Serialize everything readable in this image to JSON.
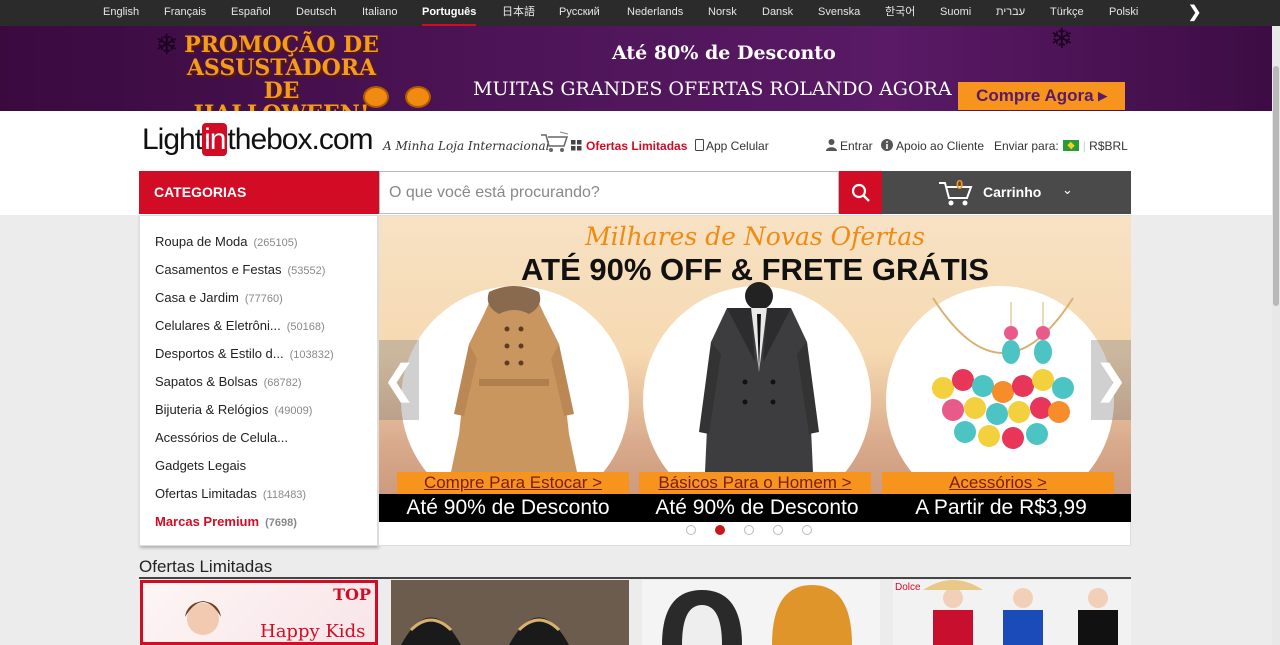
{
  "languages": [
    {
      "label": "English",
      "active": false
    },
    {
      "label": "Français",
      "active": false
    },
    {
      "label": "Español",
      "active": false
    },
    {
      "label": "Deutsch",
      "active": false
    },
    {
      "label": "Italiano",
      "active": false
    },
    {
      "label": "Português",
      "active": true
    },
    {
      "label": "日本語",
      "active": false
    },
    {
      "label": "Русский",
      "active": false
    },
    {
      "label": "Nederlands",
      "active": false
    },
    {
      "label": "Norsk",
      "active": false
    },
    {
      "label": "Dansk",
      "active": false
    },
    {
      "label": "Svenska",
      "active": false
    },
    {
      "label": "한국어",
      "active": false
    },
    {
      "label": "Suomi",
      "active": false
    },
    {
      "label": "עברית",
      "active": false
    },
    {
      "label": "Türkçe",
      "active": false
    },
    {
      "label": "Polski",
      "active": false
    }
  ],
  "promo": {
    "halloween_title": "PROMOÇÃO DE ASSUSTADORA DE HALLOWEEN!",
    "discount": "Até 80% de Desconto",
    "deals": "MUITAS GRANDES OFERTAS ROLANDO AGORA",
    "cta": "Compre Agora ▸"
  },
  "header": {
    "logo_pre": "Light",
    "logo_in": "in",
    "logo_post": "thebox.com",
    "tagline": "A Minha Loja Internacional",
    "limited_offers": "Ofertas Limitadas",
    "app": "App Celular",
    "login": "Entrar",
    "support": "Apoio ao Cliente",
    "ship_to": "Enviar para:",
    "currency": "R$BRL"
  },
  "nav": {
    "categories_label": "CATEGORIAS",
    "search_placeholder": "O que você está procurando?",
    "cart_count": "0",
    "cart_label": "Carrinho"
  },
  "categories": [
    {
      "label": "Roupa de Moda",
      "count": "(265105)"
    },
    {
      "label": "Casamentos e Festas",
      "count": "(53552)"
    },
    {
      "label": "Casa e Jardim",
      "count": "(77760)"
    },
    {
      "label": "Celulares & Eletrôni...",
      "count": "(50168)"
    },
    {
      "label": "Desportos & Estilo d...",
      "count": "(103832)"
    },
    {
      "label": "Sapatos & Bolsas",
      "count": "(68782)"
    },
    {
      "label": "Bijuteria & Relógios",
      "count": "(49009)"
    },
    {
      "label": "Acessórios de Celula...",
      "count": ""
    },
    {
      "label": "Gadgets Legais",
      "count": ""
    },
    {
      "label": "Ofertas Limitadas",
      "count": "(118483)"
    },
    {
      "label": "Marcas Premium",
      "count": "(7698)"
    }
  ],
  "banner": {
    "script": "Milhares de Novas Ofertas",
    "title": "ATÉ 90% OFF & FRETE GRÁTIS",
    "panels": [
      {
        "link": "Compre Para Estocar >",
        "caption": "Até 90% de Desconto"
      },
      {
        "link": "Básicos Para o Homem >",
        "caption": "Até 90% de Desconto"
      },
      {
        "link": "Acessórios >",
        "caption": "A Partir de R$3,99"
      }
    ],
    "active_dot": 1,
    "dot_count": 5
  },
  "section": {
    "title": "Ofertas Limitadas",
    "tile1_badge": "TOP",
    "tile1_text": "Happy Kids",
    "tile4_badge": "Dolce"
  },
  "colors": {
    "brand_red": "#d10c24",
    "accent_orange": "#f7941d",
    "cart_dark": "#4a4a4a"
  }
}
